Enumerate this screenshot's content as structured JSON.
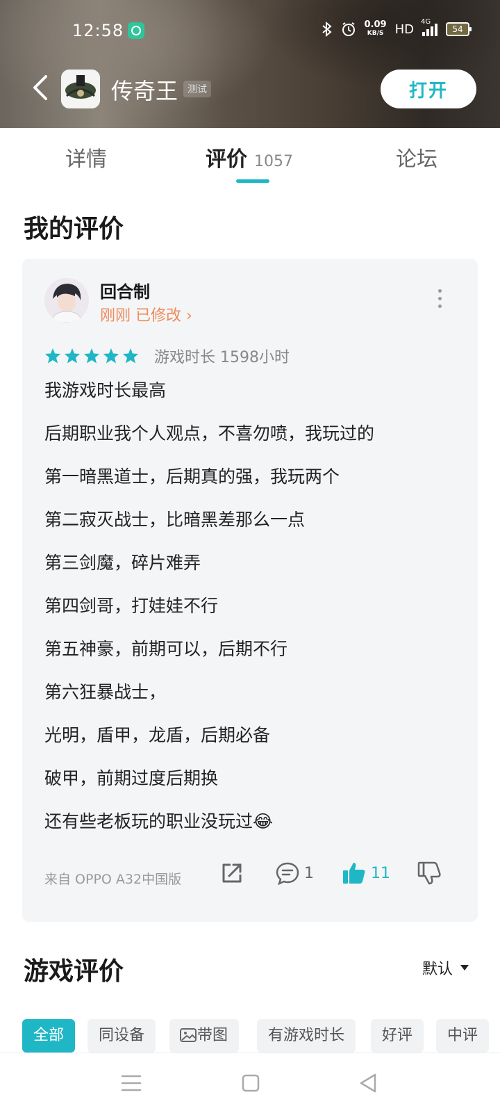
{
  "status_bar": {
    "time": "12:58",
    "net_speed_value": "0.09",
    "net_speed_unit": "KB/S",
    "hd": "HD",
    "network": "4G",
    "battery": "54"
  },
  "header": {
    "app_name": "传奇王",
    "badge": "测试",
    "open_label": "打开"
  },
  "tabs": [
    {
      "label": "详情"
    },
    {
      "label": "评价",
      "count": "1057"
    },
    {
      "label": "论坛"
    }
  ],
  "my_review": {
    "section_title": "我的评价",
    "username": "回合制",
    "edited_label": "刚刚 已修改 ›",
    "rating_stars": 5,
    "playtime": "游戏时长 1598小时",
    "lines": [
      "我游戏时长最高",
      "后期职业我个人观点，不喜勿喷，我玩过的",
      "第一暗黑道士，后期真的强，我玩两个",
      "第二寂灭战士，比暗黑差那么一点",
      "第三剑魔，碎片难弄",
      "第四剑哥，打娃娃不行",
      "第五神豪，前期可以，后期不行",
      "第六狂暴战士，",
      "光明，盾甲，龙盾，后期必备",
      "破甲，前期过度后期换",
      "还有些老板玩的职业没玩过😂"
    ],
    "source": "来自 OPPO A32中国版",
    "comment_count": "1",
    "like_count": "11"
  },
  "game_reviews": {
    "section_title": "游戏评价",
    "sort_label": "默认",
    "filters": [
      "全部",
      "同设备",
      "带图",
      "有游戏时长",
      "好评",
      "中评"
    ]
  },
  "colors": {
    "accent": "#1fb7c5",
    "edited": "#ef8a5a",
    "card_bg": "#f4f5f7"
  }
}
